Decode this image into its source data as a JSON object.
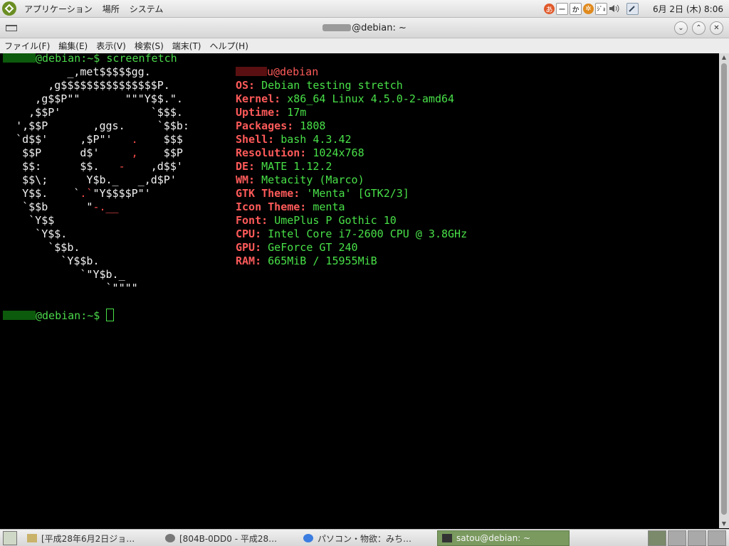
{
  "top_panel": {
    "menus": [
      "アプリケーション",
      "場所",
      "システム"
    ],
    "tray_icons": [
      "ime-hiragana-icon",
      "ime-minus-icon",
      "ime-kana-icon",
      "ime-gear-icon",
      "ime-dict-icon",
      "volume-icon",
      "input-method-icon"
    ],
    "tray_labels": {
      "hiragana": "あ",
      "minus": "ー",
      "kana": "か",
      "dict": "ｼﾞｮ"
    },
    "clock": "6月 2日 (木) 8:06"
  },
  "window": {
    "title_suffix": "@debian: ~",
    "menus": [
      "ファイル(F)",
      "編集(E)",
      "表示(V)",
      "検索(S)",
      "端末(T)",
      "ヘルプ(H)"
    ]
  },
  "terminal": {
    "prompt_suffix": "@debian:~$ ",
    "command": "screenfetch",
    "user_host_suffix": "u@debian",
    "ascii_logo": [
      "          _,met$$$$$gg.",
      "       ,g$$$$$$$$$$$$$$$P.",
      "     ,g$$P\"\"       \"\"\"Y$$.\".",
      "    ,$$P'              `$$$.",
      "  ',$$P       ,ggs.     `$$b:",
      "  `d$$'     ,$P\"'   .    $$$",
      "   $$P      d$'     ,    $$P",
      "   $$:      $$.   -    ,d$$'",
      "   $$\\;      Y$b._   _,d$P'",
      "   Y$$.    `.`\"Y$$$$P\"'",
      "   `$$b      \"-.__",
      "    `Y$$",
      "     `Y$$.",
      "       `$$b.",
      "         `Y$$b.",
      "            `\"Y$b._",
      "                `\"\"\"\""
    ],
    "info": [
      {
        "key": "OS:",
        "value": "Debian testing stretch"
      },
      {
        "key": "Kernel:",
        "value": "x86_64 Linux 4.5.0-2-amd64"
      },
      {
        "key": "Uptime:",
        "value": "17m"
      },
      {
        "key": "Packages:",
        "value": "1808"
      },
      {
        "key": "Shell:",
        "value": "bash 4.3.42"
      },
      {
        "key": "Resolution:",
        "value": "1024x768"
      },
      {
        "key": "DE:",
        "value": "MATE 1.12.2"
      },
      {
        "key": "WM:",
        "value": "Metacity (Marco)"
      },
      {
        "key": "GTK Theme:",
        "value": "'Menta' [GTK2/3]"
      },
      {
        "key": "Icon Theme:",
        "value": "menta"
      },
      {
        "key": "Font:",
        "value": "UmePlus P Gothic 10"
      },
      {
        "key": "CPU:",
        "value": "Intel Core i7-2600 CPU @ 3.8GHz"
      },
      {
        "key": "GPU:",
        "value": "GeForce GT 240"
      },
      {
        "key": "RAM:",
        "value": "665MiB / 15955MiB"
      }
    ]
  },
  "taskbar": {
    "tasks": [
      {
        "label": "[平成28年6月2日ジョ…",
        "icon": "folder-icon",
        "active": false
      },
      {
        "label": "[804B-0DD0 - 平成28…",
        "icon": "disk-icon",
        "active": false
      },
      {
        "label": "パソコン・物欲：みち…",
        "icon": "chrome-icon",
        "active": false
      },
      {
        "label": "satou@debian: ~",
        "icon": "terminal-icon",
        "active": true
      }
    ],
    "workspaces": 4
  }
}
